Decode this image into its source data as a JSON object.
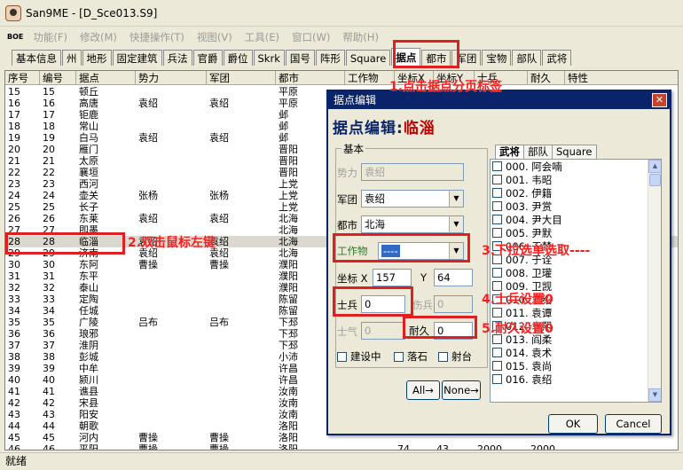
{
  "window": {
    "title": "San9ME - [D_Sce013.S9]",
    "icon": "avatar-icon"
  },
  "menubar": {
    "system_label": "BOE",
    "items": [
      "功能(F)",
      "修改(M)",
      "快捷操作(T)",
      "视图(V)",
      "工具(E)",
      "窗口(W)",
      "帮助(H)"
    ]
  },
  "tabs": [
    "基本信息",
    "州",
    "地形",
    "固定建筑",
    "兵法",
    "官爵",
    "爵位",
    "Skrk",
    "国号",
    "阵形",
    "Square",
    "据点",
    "都市",
    "军团",
    "宝物",
    "部队",
    "武将"
  ],
  "active_tab": "据点",
  "grid": {
    "columns": [
      "序号",
      "编号",
      "据点",
      "势力",
      "军团",
      "都市",
      "工作物",
      "坐标X",
      "坐标Y",
      "士兵",
      "耐久",
      "特性"
    ],
    "rows": [
      [
        "15",
        "15",
        "顿丘",
        "",
        "",
        "平原",
        "",
        "",
        "",
        "",
        "",
        ""
      ],
      [
        "16",
        "16",
        "高唐",
        "袁绍",
        "袁绍",
        "平原",
        "",
        "",
        "",
        "",
        "",
        ""
      ],
      [
        "17",
        "17",
        "钜鹿",
        "",
        "",
        "邺",
        "",
        "",
        "",
        "",
        "",
        ""
      ],
      [
        "18",
        "18",
        "常山",
        "",
        "",
        "邺",
        "",
        "",
        "",
        "",
        "",
        ""
      ],
      [
        "19",
        "19",
        "白马",
        "袁绍",
        "袁绍",
        "邺",
        "",
        "",
        "",
        "",
        "",
        ""
      ],
      [
        "20",
        "20",
        "雁门",
        "",
        "",
        "晋阳",
        "",
        "",
        "",
        "",
        "",
        ""
      ],
      [
        "21",
        "21",
        "太原",
        "",
        "",
        "晋阳",
        "",
        "",
        "",
        "",
        "",
        ""
      ],
      [
        "22",
        "22",
        "襄垣",
        "",
        "",
        "晋阳",
        "",
        "",
        "",
        "",
        "",
        ""
      ],
      [
        "23",
        "23",
        "西河",
        "",
        "",
        "上党",
        "",
        "",
        "",
        "",
        "",
        ""
      ],
      [
        "24",
        "24",
        "壶关",
        "张杨",
        "张杨",
        "上党",
        "",
        "",
        "",
        "",
        "",
        ""
      ],
      [
        "25",
        "25",
        "长子",
        "",
        "",
        "上党",
        "",
        "",
        "",
        "",
        "",
        ""
      ],
      [
        "26",
        "26",
        "东莱",
        "袁绍",
        "袁绍",
        "北海",
        "",
        "",
        "",
        "",
        "",
        ""
      ],
      [
        "27",
        "27",
        "即墨",
        "",
        "",
        "北海",
        "",
        "",
        "",
        "",
        "",
        ""
      ],
      [
        "28",
        "28",
        "临淄",
        "袁绍",
        "袁绍",
        "北海",
        "",
        "",
        "",
        "",
        "",
        ""
      ],
      [
        "29",
        "29",
        "济南",
        "袁绍",
        "袁绍",
        "北海",
        "",
        "",
        "",
        "",
        "",
        ""
      ],
      [
        "30",
        "30",
        "东阿",
        "曹操",
        "曹操",
        "濮阳",
        "",
        "",
        "",
        "",
        "",
        ""
      ],
      [
        "31",
        "31",
        "东平",
        "",
        "",
        "濮阳",
        "",
        "",
        "",
        "",
        "",
        ""
      ],
      [
        "32",
        "32",
        "泰山",
        "",
        "",
        "濮阳",
        "",
        "",
        "",
        "",
        "",
        ""
      ],
      [
        "33",
        "33",
        "定陶",
        "",
        "",
        "陈留",
        "",
        "",
        "",
        "",
        "",
        ""
      ],
      [
        "34",
        "34",
        "任城",
        "",
        "",
        "陈留",
        "",
        "",
        "",
        "",
        "",
        ""
      ],
      [
        "35",
        "35",
        "广陵",
        "吕布",
        "吕布",
        "下邳",
        "",
        "",
        "",
        "",
        "",
        ""
      ],
      [
        "36",
        "36",
        "琅邪",
        "",
        "",
        "下邳",
        "",
        "",
        "",
        "",
        "",
        ""
      ],
      [
        "37",
        "37",
        "淮阴",
        "",
        "",
        "下邳",
        "",
        "",
        "",
        "",
        "",
        ""
      ],
      [
        "38",
        "38",
        "彭城",
        "",
        "",
        "小沛",
        "",
        "",
        "",
        "",
        "",
        ""
      ],
      [
        "39",
        "39",
        "中牟",
        "",
        "",
        "许昌",
        "",
        "",
        "",
        "",
        "",
        ""
      ],
      [
        "40",
        "40",
        "颍川",
        "",
        "",
        "许昌",
        "",
        "",
        "",
        "",
        "",
        ""
      ],
      [
        "41",
        "41",
        "谯县",
        "",
        "",
        "汝南",
        "",
        "",
        "",
        "",
        "",
        ""
      ],
      [
        "42",
        "42",
        "宋县",
        "",
        "",
        "汝南",
        "",
        "",
        "",
        "",
        "",
        ""
      ],
      [
        "43",
        "43",
        "阳安",
        "",
        "",
        "汝南",
        "",
        "",
        "",
        "",
        "",
        ""
      ],
      [
        "44",
        "44",
        "朝歌",
        "",
        "",
        "洛阳",
        "",
        "",
        "",
        "",
        "",
        ""
      ],
      [
        "45",
        "45",
        "河内",
        "曹操",
        "曹操",
        "洛阳",
        "",
        "",
        "",
        "",
        "",
        ""
      ],
      [
        "46",
        "46",
        "平阳",
        "曹操",
        "曹操",
        "洛阳",
        "",
        "74",
        "43",
        "2000",
        "2000",
        ""
      ]
    ],
    "selected_row": 13
  },
  "statusbar": {
    "text": "就绪"
  },
  "dialog": {
    "title": "据点编辑",
    "heading_prefix": "据点编辑:",
    "heading_city": "临淄",
    "group_label": "基本",
    "force_label": "势力",
    "force_value": "袁绍",
    "corps_label": "军团",
    "corps_value": "袁绍",
    "city_label": "都市",
    "city_value": "北海",
    "workobj_label": "工作物",
    "workobj_value": "----",
    "coord_label": "坐标 X",
    "coord_x": "157",
    "coord_y_label": "Y",
    "coord_y": "64",
    "soldiers_label": "士兵",
    "soldiers_value": "0",
    "wounded_label": "伤兵",
    "wounded_value": "0",
    "morale_label": "士气",
    "morale_value": "0",
    "durability_label": "耐久",
    "durability_value": "0",
    "check_building": "建设中",
    "check_rock": "落石",
    "check_arrow": "射台",
    "btn_all": "All→",
    "btn_none": "None→",
    "btn_ok": "OK",
    "btn_cancel": "Cancel",
    "side_tabs": [
      "武将",
      "部队",
      "Square"
    ],
    "officers": [
      "000. 阿会喃",
      "001. 韦昭",
      "002. 伊籍",
      "003. 尹赏",
      "004. 尹大目",
      "005. 尹默",
      "006. 于禁",
      "007. 于诠",
      "008. 卫瓘",
      "009. 卫觊",
      "010. 袁绍",
      "011. 袁谭",
      "012. 袁熙",
      "013. 阎柔",
      "014. 袁术",
      "015. 袁尚",
      "016. 袁绍"
    ]
  },
  "annotations": [
    "1.点击据点分页标签",
    "2.双击鼠标左键",
    "3.下拉选单选取----",
    "4.士兵设置0",
    "5.耐久设置0"
  ],
  "colors": {
    "annotation": "#e02020",
    "dialog_title": "#0a246a",
    "heading_city": "#c00000"
  }
}
